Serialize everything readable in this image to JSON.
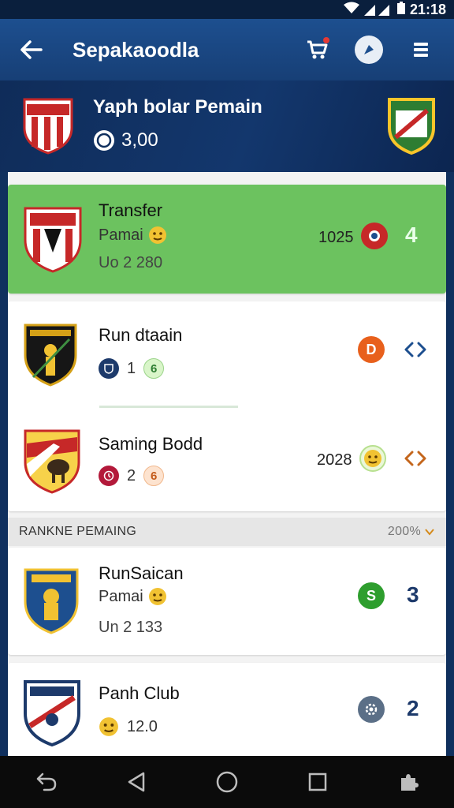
{
  "status_bar": {
    "time": "21:18"
  },
  "app_bar": {
    "title": "Sepakaoodla"
  },
  "header": {
    "title": "Yaph bolar Pemain",
    "meta_value": "3,00"
  },
  "cards": [
    {
      "title": "Transfer",
      "line2": "Pamai",
      "line3": "Uo 2 280",
      "right_value": "1025",
      "end_value": "4"
    },
    {
      "title": "Run dtaain",
      "line2_a": "1",
      "line2_b": "6",
      "badge": "D"
    },
    {
      "title": "Saming Bodd",
      "line2_a": "2",
      "line2_b": "6",
      "right_value": "2028"
    },
    {
      "title": "RunSaican",
      "line2": "Pamai",
      "line3": "Un 2 133",
      "badge": "S",
      "end_value": "3"
    },
    {
      "title": "Panh Club",
      "line2": "12.0",
      "end_value": "2"
    }
  ],
  "section": {
    "label": "RANKNE PEMAING",
    "right": "200%"
  },
  "colors": {
    "app_bar": "#1d4f8f",
    "green_card": "#6cc25f",
    "orange_badge": "#e8601c",
    "green_badge": "#2e9e2e",
    "nav": "#0b0b0b"
  }
}
